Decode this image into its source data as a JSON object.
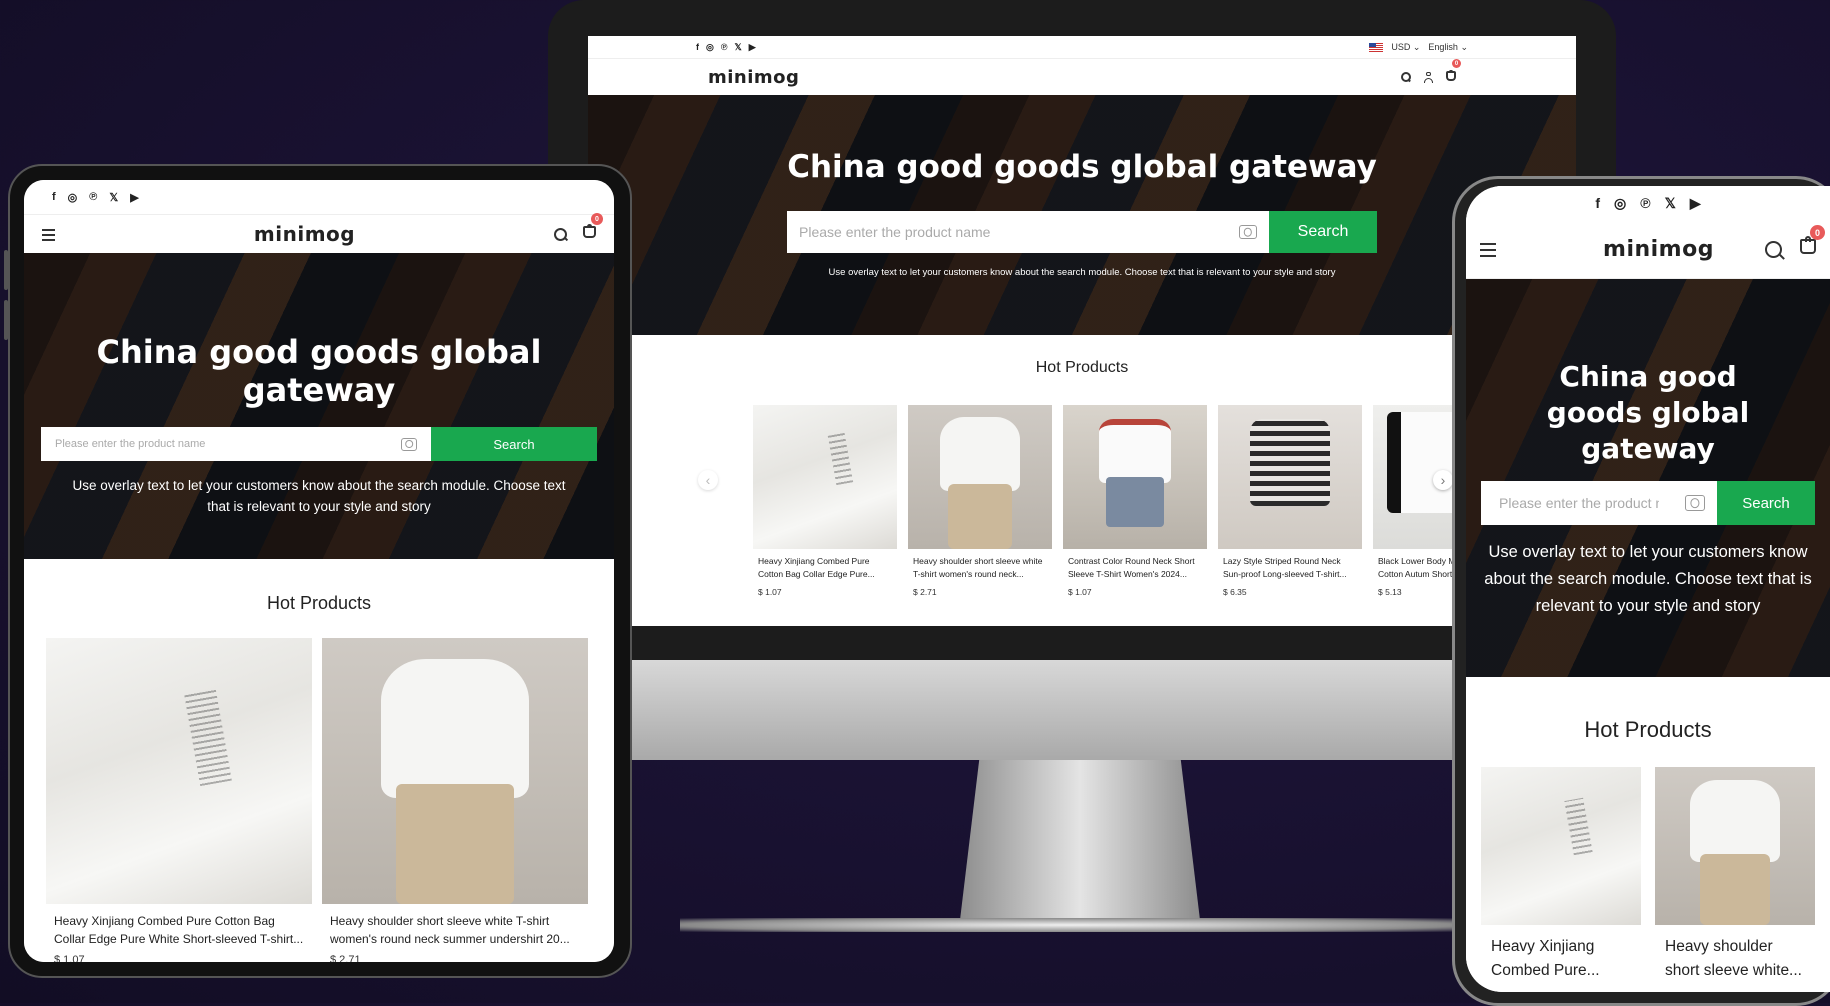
{
  "brand": {
    "logo": "minimog",
    "accent": "#19a84f",
    "badge_color": "#e85a5a"
  },
  "social_icons": [
    "facebook-icon",
    "instagram-icon",
    "pinterest-icon",
    "x-icon",
    "youtube-icon"
  ],
  "social_glyphs": {
    "facebook": "f",
    "instagram": "◎",
    "pinterest": "℗",
    "x": "𝕏",
    "youtube": "▶"
  },
  "header": {
    "currency": "USD",
    "language": "English",
    "cart_count": "0"
  },
  "hero": {
    "title": "China good goods global gateway",
    "search_placeholder": "Please enter the product name",
    "search_button": "Search",
    "overlay_text": "Use overlay text to let your customers know about the search module. Choose text that is relevant to your style and story"
  },
  "hot_products": {
    "heading": "Hot Products",
    "items": [
      {
        "desktop_title": "Heavy Xinjiang Combed Pure Cotton Bag Collar Edge Pure...",
        "tablet_title": "Heavy Xinjiang Combed Pure Cotton Bag Collar Edge Pure White Short-sleeved T-shirt...",
        "mobile_title": "Heavy Xinjiang Combed Pure...",
        "price": "$ 1.07"
      },
      {
        "desktop_title": "Heavy shoulder short sleeve white T-shirt women's round neck...",
        "tablet_title": "Heavy shoulder short sleeve white T-shirt women's round neck summer undershirt 20...",
        "mobile_title": "Heavy shoulder short sleeve white...",
        "price": "$ 2.71"
      },
      {
        "desktop_title": "Contrast Color Round Neck Short Sleeve T-Shirt Women's 2024...",
        "price": "$ 1.07"
      },
      {
        "desktop_title": "Lazy Style Striped Round Neck Sun-proof Long-sleeved T-shirt...",
        "price": "$ 6.35"
      },
      {
        "desktop_title": "Black Lower Body Missing Pure Cotton Autum Shorts for Women...",
        "price": "$ 5.13"
      }
    ]
  },
  "carousel": {
    "prev": "‹",
    "next": "›"
  }
}
